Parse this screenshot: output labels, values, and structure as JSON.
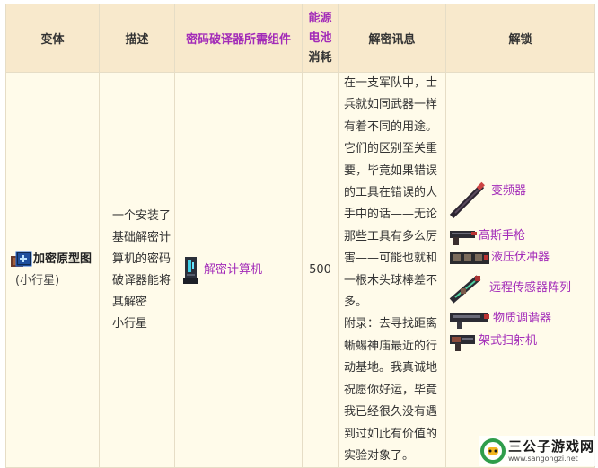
{
  "table": {
    "headers": {
      "variant": "变体",
      "description": "描述",
      "decoder_component": "密码破译器所需组件",
      "power_line1": "能源",
      "power_line2": "电池",
      "power_line3": "消耗",
      "info": "解密讯息",
      "unlock": "解锁"
    },
    "row": {
      "variant_name": "加密原型图",
      "variant_sub": "(小行星)",
      "description_lines": [
        "一个安装了",
        "基础解密计",
        "算机的密码",
        "破译器能将",
        "其解密",
        "小行星"
      ],
      "component": "解密计算机",
      "power": "500",
      "info_lines": [
        "在一支军队中，士",
        "兵就如同武器一样",
        "有着不同的用途。",
        "它们的区别至关重",
        "要，毕竟如果错误",
        "的工具在错误的人",
        "手中的话——无论",
        "那些工具有多么厉",
        "害——可能也就和",
        "一根木头球棒差不",
        "多。",
        "附录：去寻找距离",
        "蜥蜴神庙最近的行",
        "动基地。我真诚地",
        "祝愿你好运，毕竟",
        "我已经很久没有遇",
        "到过如此有价值的",
        "实验对象了。"
      ],
      "unlocks": [
        "变频器",
        "高斯手枪",
        "液压伏冲器",
        "远程传感器阵列",
        "物质调谐器",
        "架式扫射机"
      ]
    }
  },
  "watermark": {
    "title": "三公子游戏网",
    "url": "www.sangongzi.net"
  },
  "colors": {
    "header_bg": "#f8e9cc",
    "cell_bg": "#fffbea",
    "link_purple": "#a22ab8"
  }
}
